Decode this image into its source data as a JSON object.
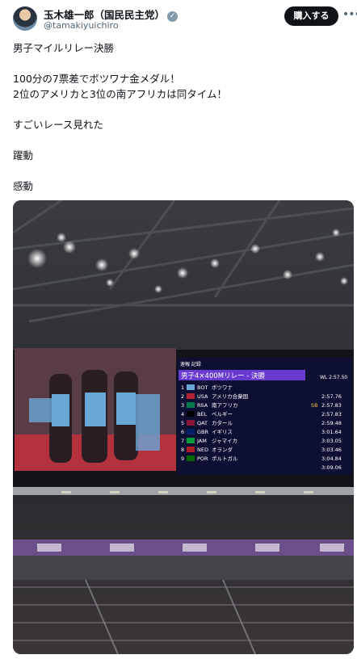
{
  "author": {
    "name": "玉木雄一郎（国民民主党）",
    "handle": "@tamakiyuichiro",
    "verified_icon": "verified-badge-icon"
  },
  "buy_button": "購入する",
  "more_icon": "more-horizontal-icon",
  "post_lines": [
    "男子マイルリレー決勝",
    "",
    "100分の7票差でボツワナ金メダル！",
    "2位のアメリカと3位の南アフリカは同タイム！",
    "",
    "すごいレース見れた",
    "",
    "躍動",
    "",
    "感動"
  ],
  "scoreboard": {
    "header": "速報 記録",
    "title": "男子4×400Mリレー - 決勝",
    "record": "WL 2:57.50",
    "rows": [
      {
        "rank": "1",
        "code": "BOT",
        "name": "ボツワナ",
        "note": "",
        "time": ""
      },
      {
        "rank": "2",
        "code": "USA",
        "name": "アメリカ合衆国",
        "note": "",
        "time": "2:57.76"
      },
      {
        "rank": "3",
        "code": "RSA",
        "name": "南アフリカ",
        "note": "SB",
        "time": "2:57.83"
      },
      {
        "rank": "4",
        "code": "BEL",
        "name": "ベルギー",
        "note": "",
        "time": "2:57.83"
      },
      {
        "rank": "5",
        "code": "QAT",
        "name": "カタール",
        "note": "",
        "time": "2:59.48"
      },
      {
        "rank": "6",
        "code": "GBR",
        "name": "イギリス",
        "note": "",
        "time": "3:01.64"
      },
      {
        "rank": "7",
        "code": "JAM",
        "name": "ジャマイカ",
        "note": "",
        "time": "3:03.05"
      },
      {
        "rank": "8",
        "code": "NED",
        "name": "オランダ",
        "note": "",
        "time": "3:03.46"
      },
      {
        "rank": "9",
        "code": "POR",
        "name": "ポルトガル",
        "note": "",
        "time": "3:04.84"
      }
    ],
    "extra_time": "3:09.06"
  },
  "colors": {
    "banner": "#6a3bd1",
    "board": "#0d1033",
    "text_secondary": "#536471"
  }
}
